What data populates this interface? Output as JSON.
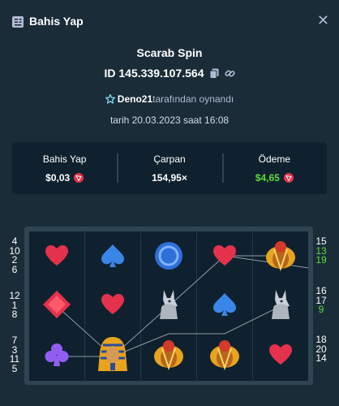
{
  "header": {
    "title": "Bahis Yap",
    "close": "✕"
  },
  "game": {
    "name": "Scarab Spin",
    "id": "ID 145.339.107.564",
    "player": "Deno21",
    "player_suffix": "tarafından oynandı",
    "date": "tarih 20.03.2023 saat 16:08"
  },
  "stats": {
    "bet_label": "Bahis Yap",
    "bet_value": "$0,03",
    "multiplier_label": "Çarpan",
    "multiplier_value": "154,95×",
    "payout_label": "Ödeme",
    "payout_value": "$4,65"
  },
  "paylines": {
    "left": [
      [
        "4",
        "10",
        "2",
        "6"
      ],
      [
        "12",
        "1",
        "8"
      ],
      [
        "7",
        "3",
        "11",
        "5"
      ]
    ],
    "right": [
      [
        "15",
        "13",
        "19"
      ],
      [
        "16",
        "17",
        "9"
      ],
      [
        "18",
        "20",
        "14"
      ]
    ],
    "winning": [
      "13",
      "19",
      "9"
    ]
  },
  "board": {
    "rows": [
      [
        "heart",
        "spade",
        "ring",
        "heart",
        "scarab"
      ],
      [
        "diamond",
        "heart",
        "anubis",
        "spade",
        "anubis"
      ],
      [
        "club",
        "pharaoh",
        "scarab",
        "scarab",
        "heart"
      ]
    ]
  },
  "colors": {
    "background": "#1a2c38",
    "panel": "#0f212e",
    "win_green": "#5edc3c",
    "heart_red": "#e4324c",
    "spade_blue": "#3a86e8",
    "club_purple": "#8f5ef0",
    "coin_red": "#e8314a"
  }
}
